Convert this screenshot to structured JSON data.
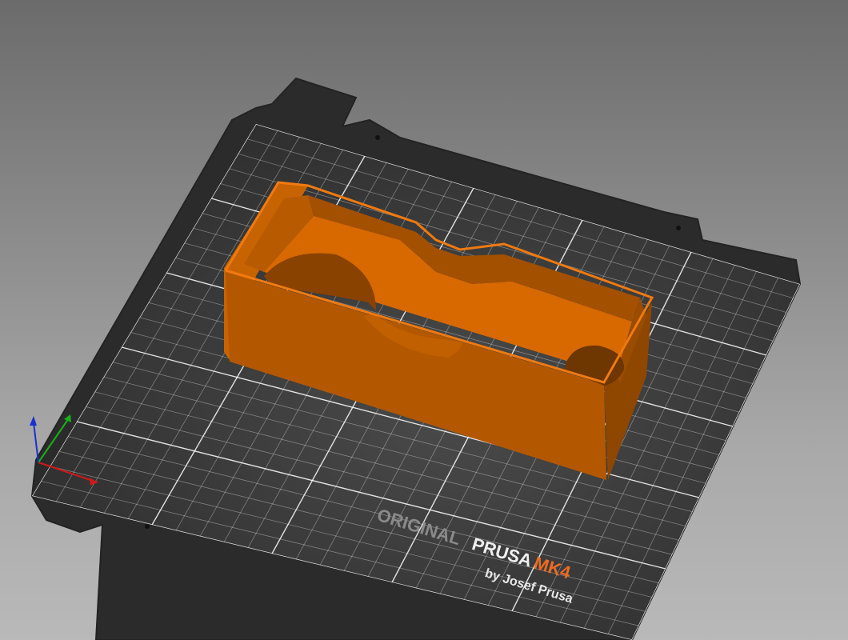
{
  "viewport": {
    "background_top": "#6b6b6b",
    "background_bottom": "#b9b9b9"
  },
  "bed": {
    "plate_color": "#333333",
    "grid_color": "#ffffff",
    "logo": {
      "word_original": "ORIGINAL",
      "word_prusa": "PRUSA",
      "word_model": "MK4",
      "byline": "by Josef Prusa",
      "accent_color": "#ed6b21"
    }
  },
  "model": {
    "color_top": "#e46e00",
    "color_side": "#a85200",
    "color_shadow": "#7a3c00"
  },
  "axes": {
    "x_color": "#d01818",
    "y_color": "#18b018",
    "z_color": "#1830d0"
  }
}
